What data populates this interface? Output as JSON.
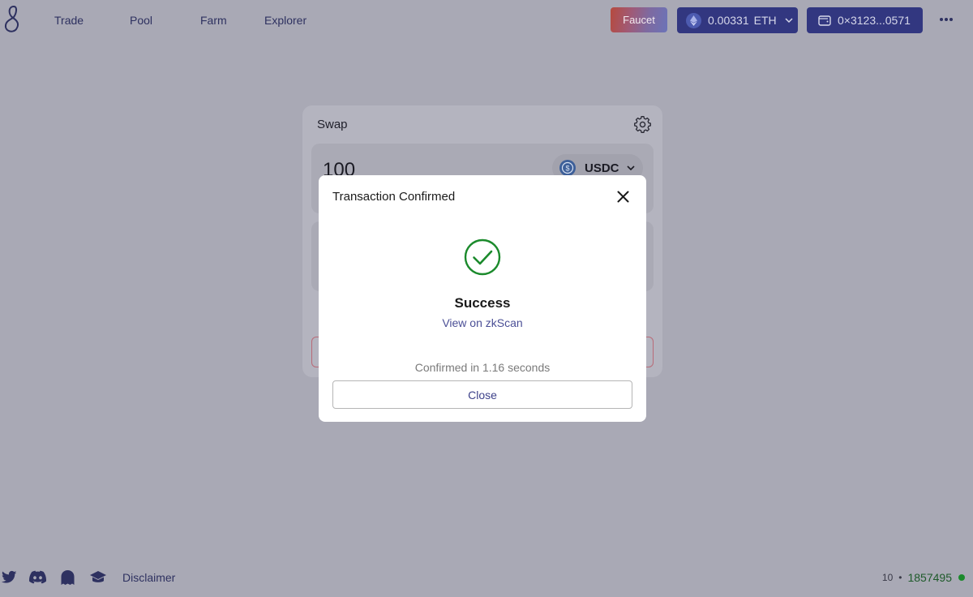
{
  "nav": {
    "items": [
      {
        "label": "Trade"
      },
      {
        "label": "Pool"
      },
      {
        "label": "Farm"
      },
      {
        "label": "Explorer"
      }
    ]
  },
  "header": {
    "faucet_label": "Faucet",
    "eth_balance": "0.00331",
    "eth_unit": "ETH",
    "wallet_address": "0×3123...0571"
  },
  "swap": {
    "title": "Swap",
    "amount_value": "100",
    "token": "USDC"
  },
  "modal": {
    "title": "Transaction Confirmed",
    "status": "Success",
    "link_label": "View on zkScan",
    "confirmed_text": "Confirmed in 1.16 seconds",
    "close_label": "Close"
  },
  "footer": {
    "disclaimer_label": "Disclaimer",
    "gas_value": "10",
    "separator": "•",
    "block_number": "1857495"
  },
  "colors": {
    "brand_button": "#323780",
    "success": "#1b8a2c",
    "link": "#4b4f96"
  },
  "icons": {
    "logo": "logo-icon",
    "eth": "eth-icon",
    "wallet": "wallet-icon",
    "more": "more-icon",
    "settings": "gear-icon",
    "token": "usdc-icon",
    "close": "close-icon",
    "success": "check-circle-icon",
    "social": [
      "twitter-icon",
      "discord-icon",
      "ghost-icon",
      "docs-icon"
    ]
  }
}
